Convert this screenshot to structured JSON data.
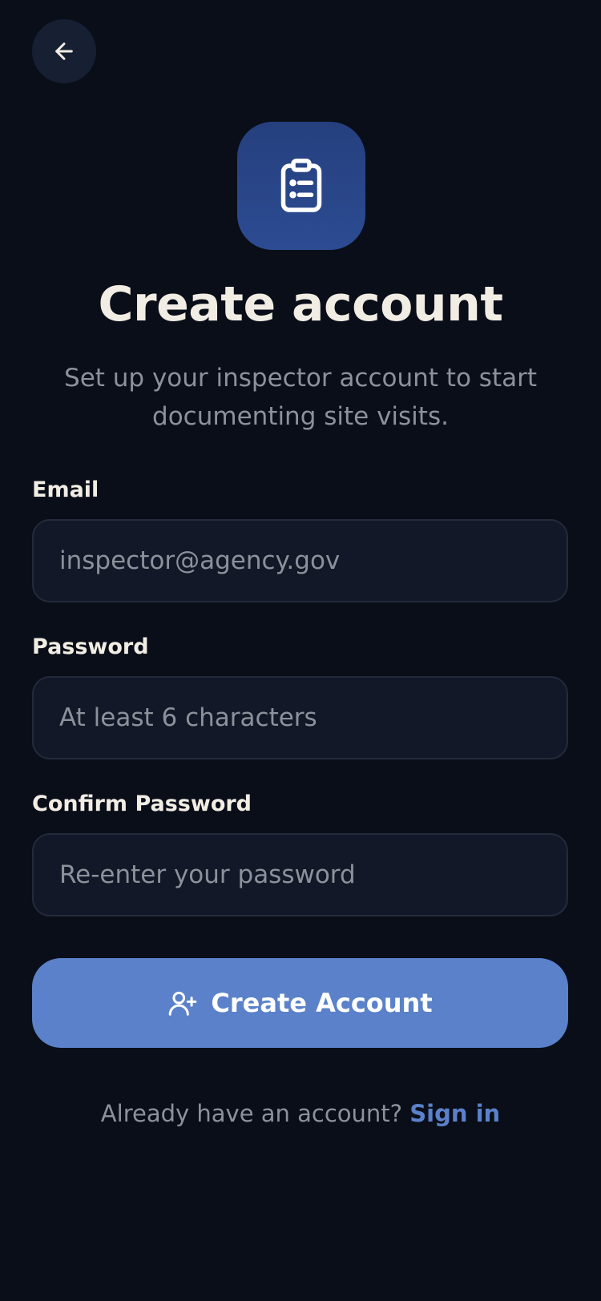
{
  "header": {
    "back_icon": "arrow-left-icon"
  },
  "logo": {
    "icon": "clipboard-list-icon",
    "color": "#2a4488"
  },
  "title": "Create account",
  "subtitle": "Set up your inspector account to start documenting site visits.",
  "form": {
    "email": {
      "label": "Email",
      "placeholder": "inspector@agency.gov",
      "value": ""
    },
    "password": {
      "label": "Password",
      "placeholder": "At least 6 characters",
      "value": ""
    },
    "confirm_password": {
      "label": "Confirm Password",
      "placeholder": "Re-enter your password",
      "value": ""
    },
    "submit": {
      "label": "Create Account",
      "icon": "user-plus-icon",
      "color": "#5a81c9"
    }
  },
  "footer": {
    "prompt": "Already have an account?",
    "link": "Sign in"
  },
  "colors": {
    "background": "#0a0e18",
    "accent": "#5a81c9",
    "text_muted": "#8d919b"
  }
}
